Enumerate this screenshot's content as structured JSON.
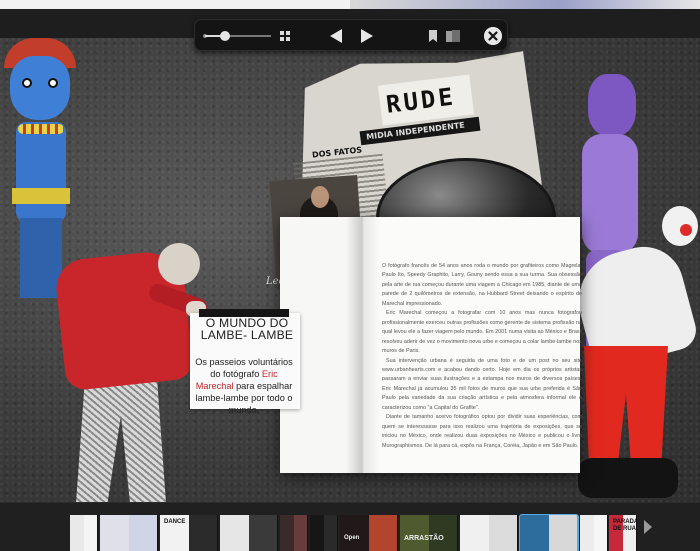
{
  "toolbar": {
    "zoom_level": 0.3,
    "icons": {
      "zoom_min": "zoom-out-dot",
      "grid": "grid-icon",
      "prev": "triangle-left-icon",
      "next": "triangle-right-icon",
      "bookmark": "bookmark-icon",
      "pages": "pages-icon",
      "close": "close-x-icon"
    }
  },
  "collage": {
    "newspaper_masthead": "RUDE",
    "newspaper_banner": "MIDIA INDEPENDENTE",
    "newspaper_section": "DOS FATOS",
    "portrait_caption": "Leo & Pipo"
  },
  "headline": {
    "title": "O MUNDO DO LAMBE- LAMBE",
    "subtitle_before": "Os passeios voluntários do fotógrafo ",
    "subtitle_highlight": "Eric Marechal",
    "subtitle_after": " para espalhar lambe-lambe por todo o mundo."
  },
  "article": {
    "paragraphs": [
      "O fotógrafo francês de 54 anos anos roda o mundo por grafiteiros como Magrela, Paulo Ito, Speedy Graphito, Larry, Gouny sendo essa a sua turma. Sua obsessão pela arte de rua começou durante uma viagem a Chicago em 1985, diante de uma parede de 2 quilômetros de extensão, na Hubbard Street deixando o espírito de Marechal impressionado.",
      "Eric Marechal começou a fotografar com 10 anos mas nunca fotografou profissionalmente exerceu outras profissões como gerente de sistema profissão na qual levou ele a fazer viagem pelo mundo. Em 2001 numa visita ao México e Brasil resolveu aderir de vez o movimento nova urbe e começou a colar lambe-lambe nos muros de Paris.",
      "Sua intervenção urbana é seguida de uma foto e de um post no seu site www.urbanhearts.com e acabou dando certo. Hoje em dia os próprios artistas passaram a enviar suas ilustrações e a estampa nos muros de diversos países. Eric Marechal já acumulou 35 mil fotos de muros que sua urbe preferida é São Paulo pela variedade da sua criação artística e pela atmosfera informal ele a caracterizou como \"a Capital do Grafite\".",
      "Diante de tamanho acervo fotográfico optou por dividir suas experiências, com quem se interessasse para isso realizou uma trajetória de exposições, que se iniciou no México, onde realizou duas exposições no México e publicou o livro Murographismos. De lá para cá, expôs na França, Coréia, Japão e em São Paulo."
    ]
  },
  "thumbnails": {
    "labels": [
      "",
      "",
      "DANCE",
      "",
      "",
      "",
      "Open",
      "ARRASTÃO",
      "",
      "",
      "",
      "PARADA DE RUA"
    ],
    "selected_index": 9,
    "next_icon": "chevron-right-icon"
  },
  "colors": {
    "toolbar_bg": "#141414",
    "accent_red": "#c0272d",
    "selection_blue": "#56a9e5"
  }
}
